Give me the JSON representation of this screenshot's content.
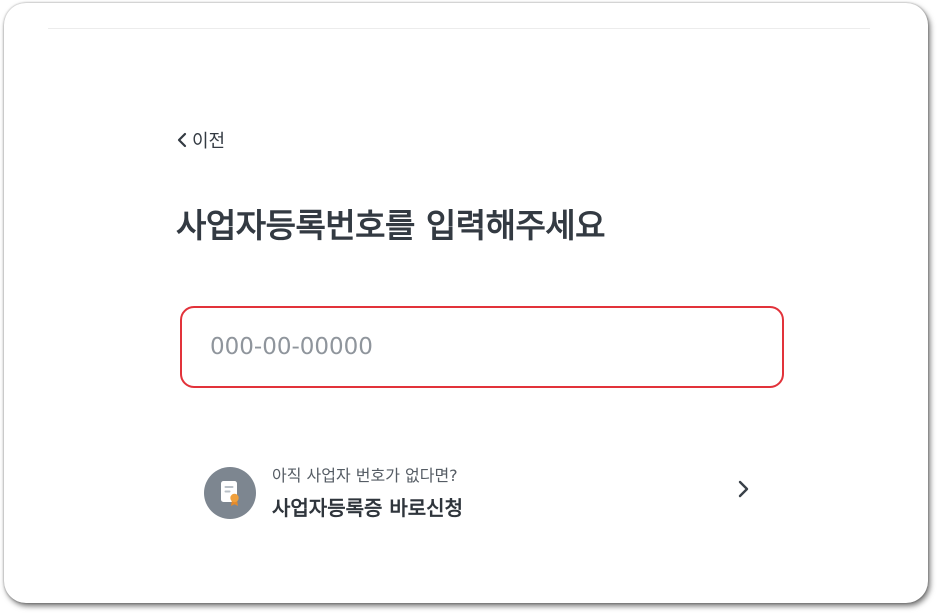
{
  "nav": {
    "back_label": "이전"
  },
  "main": {
    "title": "사업자등록번호를 입력해주세요",
    "business_number": {
      "value": "",
      "placeholder": "000-00-00000"
    },
    "apply_link": {
      "question": "아직 사업자 번호가 없다면?",
      "label": "사업자등록증 바로신청"
    }
  },
  "colors": {
    "accent_error": "#e2323a",
    "text_primary": "#333a42",
    "icon_bg": "#7d8690",
    "icon_badge": "#f0a03c"
  },
  "icons": {
    "back": "chevron-left-icon",
    "certificate": "certificate-icon",
    "forward": "chevron-right-icon"
  }
}
